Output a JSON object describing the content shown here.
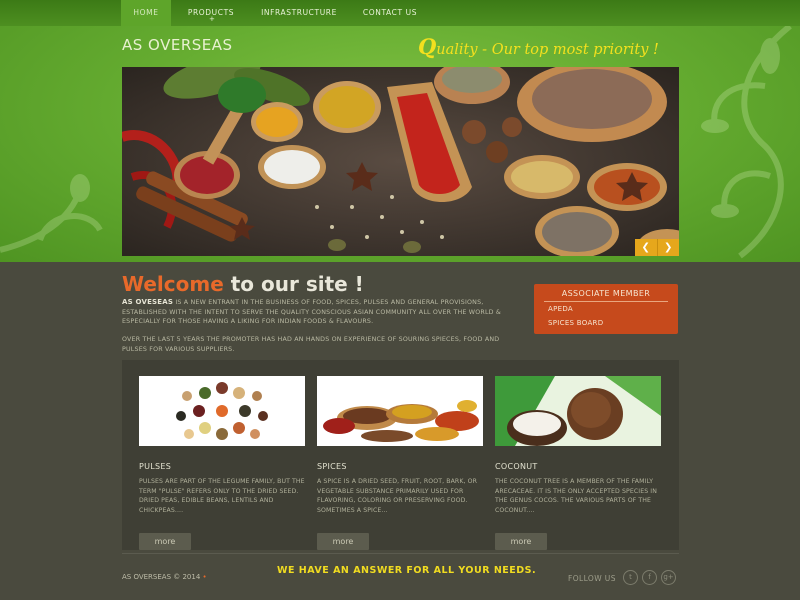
{
  "nav": {
    "home": "HOME",
    "products": "PRODUCTS",
    "infrastructure": "INFRASTRUCTURE",
    "contact": "CONTACT US",
    "products_marker": "+"
  },
  "header": {
    "brand": "AS OVERSEAS",
    "tagline_q": "Q",
    "tagline_rest": "uality - Our top most priority !"
  },
  "slider": {
    "prev": "❮",
    "next": "❯"
  },
  "welcome": {
    "title_accent": "Welcome",
    "title_rest": " to our site !",
    "p1_lead": "AS OVESEAS",
    "p1_rest": " IS A NEW ENTRANT IN THE BUSINESS OF FOOD, SPICES, PULSES AND GENERAL PROVISIONS, ESTABLISHED WITH THE INTENT TO SERVE THE QUALITY CONSCIOUS ASIAN COMMUNITY ALL OVER THE WORLD & ESPECIALLY FOR THOSE HAVING A LIKING FOR INDIAN FOODS & FLAVOURS.",
    "p2": "OVER THE LAST 5 YEARS THE PROMOTER HAS HAD AN HANDS ON EXPERIENCE OF SOURING SPIECES, FOOD AND PULSES FOR VARIOUS SUPPLIERS."
  },
  "associate": {
    "title": "ASSOCIATE MEMBER",
    "items": [
      "APEDA",
      "SPICES BOARD"
    ]
  },
  "products": [
    {
      "title": "PULSES",
      "desc": "PULSES ARE PART OF THE LEGUME FAMILY, BUT THE TERM \"PULSE\" REFERS ONLY TO THE DRIED SEED. DRIED PEAS, EDIBLE BEANS, LENTILS AND CHICKPEAS....",
      "more": "more"
    },
    {
      "title": "SPICES",
      "desc": "A SPICE IS A DRIED SEED, FRUIT, ROOT, BARK, OR VEGETABLE SUBSTANCE PRIMARILY USED FOR FLAVORING, COLORING OR PRESERVING FOOD. SOMETIMES A SPICE...",
      "more": "more"
    },
    {
      "title": "COCONUT",
      "desc": "THE COCONUT TREE IS A MEMBER OF THE FAMILY ARECACEAE. IT IS THE ONLY ACCEPTED SPECIES IN THE GENUS COCOS. THE VARIOUS PARTS OF THE COCONUT....",
      "more": "more"
    }
  ],
  "footer": {
    "copyright": "AS OVERSEAS © 2014",
    "copyright_dot": "•",
    "answer": "WE HAVE AN ANSWER FOR ALL YOUR NEEDS.",
    "follow": "FOLLOW US",
    "social_icons": [
      "twitter-icon",
      "facebook-icon",
      "google-plus-icon"
    ],
    "social_glyphs": [
      "t",
      "f",
      "g+"
    ]
  },
  "colors": {
    "accent_orange": "#e8692a",
    "tagline_yellow": "#f3e01e",
    "associate_bg": "#c64a1c",
    "green": "#66ad31"
  }
}
